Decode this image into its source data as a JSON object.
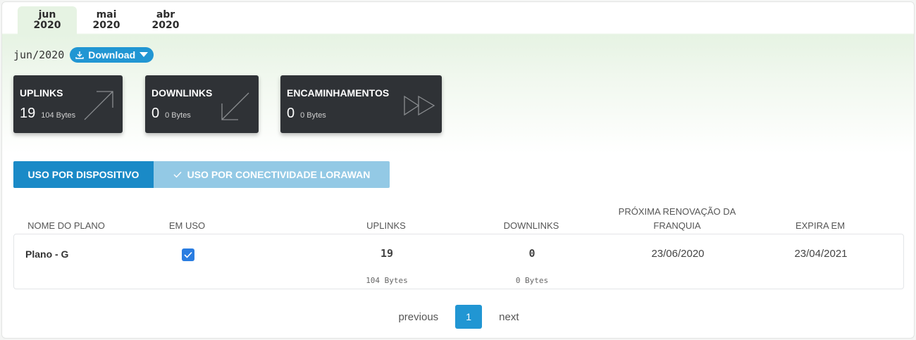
{
  "tabs": [
    {
      "month": "jun",
      "year": "2020",
      "active": true
    },
    {
      "month": "mai",
      "year": "2020",
      "active": false
    },
    {
      "month": "abr",
      "year": "2020",
      "active": false
    }
  ],
  "period": "jun/2020",
  "download_label": "Download",
  "cards": {
    "uplinks": {
      "title": "UPLINKS",
      "count": "19",
      "bytes": "104 Bytes"
    },
    "downlinks": {
      "title": "DOWNLINKS",
      "count": "0",
      "bytes": "0 Bytes"
    },
    "forwards": {
      "title": "ENCAMINHAMENTOS",
      "count": "0",
      "bytes": "0 Bytes"
    }
  },
  "view_toggle": {
    "by_device": "USO POR DISPOSITIVO",
    "by_lorawan": "USO POR CONECTIVIDADE LORAWAN"
  },
  "table": {
    "headers": {
      "plan_name": "NOME DO PLANO",
      "in_use": "EM USO",
      "uplinks": "UPLINKS",
      "downlinks": "DOWNLINKS",
      "renewal_line1": "PRÓXIMA RENOVAÇÃO DA",
      "renewal_line2": "FRANQUIA",
      "expires": "EXPIRA EM"
    },
    "row": {
      "plan": "Plano - G",
      "in_use": true,
      "uplinks": "19",
      "uplinks_bytes": "104 Bytes",
      "downlinks": "0",
      "downlinks_bytes": "0 Bytes",
      "renewal": "23/06/2020",
      "expires": "23/04/2021"
    }
  },
  "pagination": {
    "previous": "previous",
    "current": "1",
    "next": "next"
  },
  "colors": {
    "accent": "#2196d3",
    "card_bg": "#2f3236",
    "checkbox": "#2a7de1",
    "toggle_inactive": "#93c9e5"
  }
}
